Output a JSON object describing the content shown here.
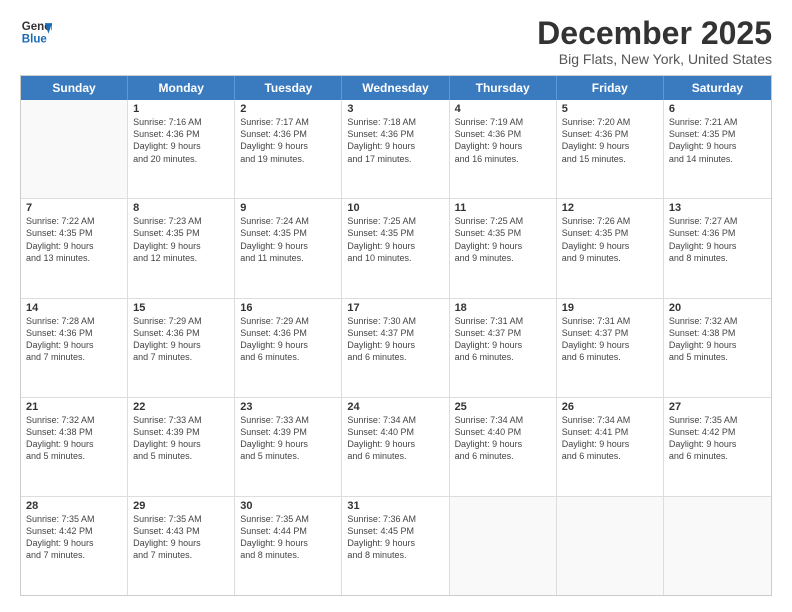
{
  "logo": {
    "line1": "General",
    "line2": "Blue"
  },
  "title": "December 2025",
  "subtitle": "Big Flats, New York, United States",
  "weekdays": [
    "Sunday",
    "Monday",
    "Tuesday",
    "Wednesday",
    "Thursday",
    "Friday",
    "Saturday"
  ],
  "weeks": [
    [
      {
        "day": "",
        "info": ""
      },
      {
        "day": "1",
        "info": "Sunrise: 7:16 AM\nSunset: 4:36 PM\nDaylight: 9 hours\nand 20 minutes."
      },
      {
        "day": "2",
        "info": "Sunrise: 7:17 AM\nSunset: 4:36 PM\nDaylight: 9 hours\nand 19 minutes."
      },
      {
        "day": "3",
        "info": "Sunrise: 7:18 AM\nSunset: 4:36 PM\nDaylight: 9 hours\nand 17 minutes."
      },
      {
        "day": "4",
        "info": "Sunrise: 7:19 AM\nSunset: 4:36 PM\nDaylight: 9 hours\nand 16 minutes."
      },
      {
        "day": "5",
        "info": "Sunrise: 7:20 AM\nSunset: 4:36 PM\nDaylight: 9 hours\nand 15 minutes."
      },
      {
        "day": "6",
        "info": "Sunrise: 7:21 AM\nSunset: 4:35 PM\nDaylight: 9 hours\nand 14 minutes."
      }
    ],
    [
      {
        "day": "7",
        "info": "Sunrise: 7:22 AM\nSunset: 4:35 PM\nDaylight: 9 hours\nand 13 minutes."
      },
      {
        "day": "8",
        "info": "Sunrise: 7:23 AM\nSunset: 4:35 PM\nDaylight: 9 hours\nand 12 minutes."
      },
      {
        "day": "9",
        "info": "Sunrise: 7:24 AM\nSunset: 4:35 PM\nDaylight: 9 hours\nand 11 minutes."
      },
      {
        "day": "10",
        "info": "Sunrise: 7:25 AM\nSunset: 4:35 PM\nDaylight: 9 hours\nand 10 minutes."
      },
      {
        "day": "11",
        "info": "Sunrise: 7:25 AM\nSunset: 4:35 PM\nDaylight: 9 hours\nand 9 minutes."
      },
      {
        "day": "12",
        "info": "Sunrise: 7:26 AM\nSunset: 4:35 PM\nDaylight: 9 hours\nand 9 minutes."
      },
      {
        "day": "13",
        "info": "Sunrise: 7:27 AM\nSunset: 4:36 PM\nDaylight: 9 hours\nand 8 minutes."
      }
    ],
    [
      {
        "day": "14",
        "info": "Sunrise: 7:28 AM\nSunset: 4:36 PM\nDaylight: 9 hours\nand 7 minutes."
      },
      {
        "day": "15",
        "info": "Sunrise: 7:29 AM\nSunset: 4:36 PM\nDaylight: 9 hours\nand 7 minutes."
      },
      {
        "day": "16",
        "info": "Sunrise: 7:29 AM\nSunset: 4:36 PM\nDaylight: 9 hours\nand 6 minutes."
      },
      {
        "day": "17",
        "info": "Sunrise: 7:30 AM\nSunset: 4:37 PM\nDaylight: 9 hours\nand 6 minutes."
      },
      {
        "day": "18",
        "info": "Sunrise: 7:31 AM\nSunset: 4:37 PM\nDaylight: 9 hours\nand 6 minutes."
      },
      {
        "day": "19",
        "info": "Sunrise: 7:31 AM\nSunset: 4:37 PM\nDaylight: 9 hours\nand 6 minutes."
      },
      {
        "day": "20",
        "info": "Sunrise: 7:32 AM\nSunset: 4:38 PM\nDaylight: 9 hours\nand 5 minutes."
      }
    ],
    [
      {
        "day": "21",
        "info": "Sunrise: 7:32 AM\nSunset: 4:38 PM\nDaylight: 9 hours\nand 5 minutes."
      },
      {
        "day": "22",
        "info": "Sunrise: 7:33 AM\nSunset: 4:39 PM\nDaylight: 9 hours\nand 5 minutes."
      },
      {
        "day": "23",
        "info": "Sunrise: 7:33 AM\nSunset: 4:39 PM\nDaylight: 9 hours\nand 5 minutes."
      },
      {
        "day": "24",
        "info": "Sunrise: 7:34 AM\nSunset: 4:40 PM\nDaylight: 9 hours\nand 6 minutes."
      },
      {
        "day": "25",
        "info": "Sunrise: 7:34 AM\nSunset: 4:40 PM\nDaylight: 9 hours\nand 6 minutes."
      },
      {
        "day": "26",
        "info": "Sunrise: 7:34 AM\nSunset: 4:41 PM\nDaylight: 9 hours\nand 6 minutes."
      },
      {
        "day": "27",
        "info": "Sunrise: 7:35 AM\nSunset: 4:42 PM\nDaylight: 9 hours\nand 6 minutes."
      }
    ],
    [
      {
        "day": "28",
        "info": "Sunrise: 7:35 AM\nSunset: 4:42 PM\nDaylight: 9 hours\nand 7 minutes."
      },
      {
        "day": "29",
        "info": "Sunrise: 7:35 AM\nSunset: 4:43 PM\nDaylight: 9 hours\nand 7 minutes."
      },
      {
        "day": "30",
        "info": "Sunrise: 7:35 AM\nSunset: 4:44 PM\nDaylight: 9 hours\nand 8 minutes."
      },
      {
        "day": "31",
        "info": "Sunrise: 7:36 AM\nSunset: 4:45 PM\nDaylight: 9 hours\nand 8 minutes."
      },
      {
        "day": "",
        "info": ""
      },
      {
        "day": "",
        "info": ""
      },
      {
        "day": "",
        "info": ""
      }
    ]
  ]
}
